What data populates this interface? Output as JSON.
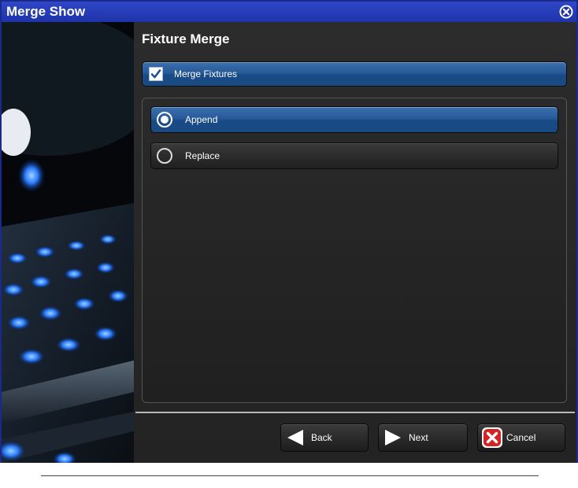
{
  "window": {
    "title": "Merge Show",
    "close_icon": "close-circle-icon"
  },
  "panel": {
    "heading": "Fixture Merge",
    "merge_fixtures": {
      "label": "Merge Fixtures",
      "checked": true
    },
    "options": [
      {
        "label": "Append",
        "selected": true
      },
      {
        "label": "Replace",
        "selected": false
      }
    ]
  },
  "footer": {
    "back_label": "Back",
    "next_label": "Next",
    "cancel_label": "Cancel"
  },
  "colors": {
    "title_bar": "#2a3fc0",
    "selected": "#285a98",
    "cancel_icon": "#d42323"
  }
}
